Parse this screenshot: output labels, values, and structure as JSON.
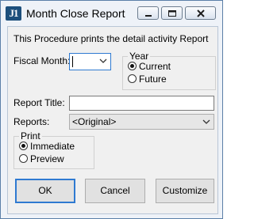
{
  "window": {
    "title": "Month Close Report",
    "icon_text": "J1"
  },
  "form": {
    "description": "This Procedure prints the detail activity Report",
    "fiscal_month": {
      "label": "Fiscal Month:",
      "value": ""
    },
    "year": {
      "title": "Year",
      "options": [
        {
          "label": "Current",
          "selected": true
        },
        {
          "label": "Future",
          "selected": false
        }
      ]
    },
    "report_title": {
      "label": "Report Title:",
      "value": ""
    },
    "reports": {
      "label": "Reports:",
      "value": "<Original>"
    },
    "print": {
      "title": "Print",
      "options": [
        {
          "label": "Immediate",
          "selected": true
        },
        {
          "label": "Preview",
          "selected": false
        }
      ]
    }
  },
  "buttons": {
    "ok": "OK",
    "cancel": "Cancel",
    "customize": "Customize"
  },
  "colors": {
    "accent": "#2f7ad1",
    "frame": "#5b7fa8",
    "icon_bg": "#1c4f7c"
  }
}
